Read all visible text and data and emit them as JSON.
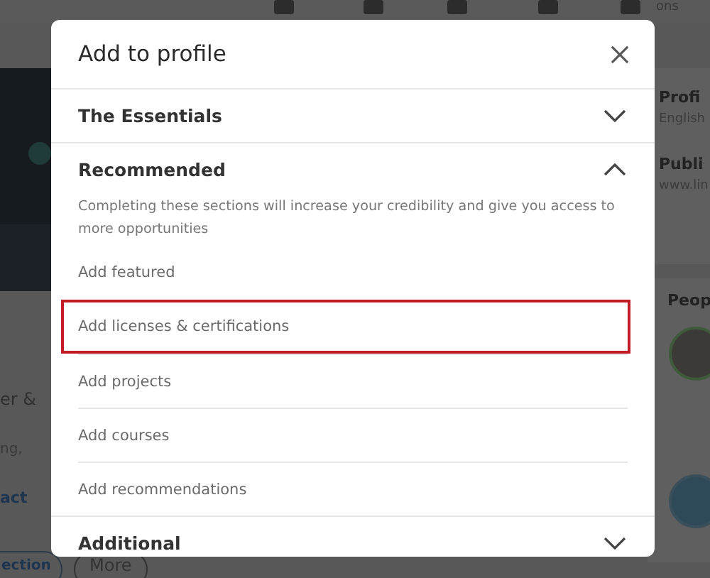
{
  "background": {
    "nav_text": "ons",
    "left_texts": [
      "er &",
      "ng,",
      "act"
    ],
    "left_buttons": [
      "ection",
      "More"
    ],
    "right_cards": [
      {
        "title": "Profi",
        "subtitle": "English"
      },
      {
        "title": "Publi",
        "subtitle": "www.lin"
      }
    ],
    "people_title": "Peop"
  },
  "dialog": {
    "title": "Add to profile",
    "sections": [
      {
        "label": "The Essentials",
        "expanded": false
      },
      {
        "label": "Recommended",
        "expanded": true,
        "description": "Completing these sections will increase your credibility and give you access to more opportunities",
        "items": [
          {
            "label": "Add featured",
            "highlighted": false
          },
          {
            "label": "Add licenses & certifications",
            "highlighted": true
          },
          {
            "label": "Add projects",
            "highlighted": false
          },
          {
            "label": "Add courses",
            "highlighted": false
          },
          {
            "label": "Add recommendations",
            "highlighted": false
          }
        ]
      },
      {
        "label": "Additional",
        "expanded": false
      }
    ]
  }
}
